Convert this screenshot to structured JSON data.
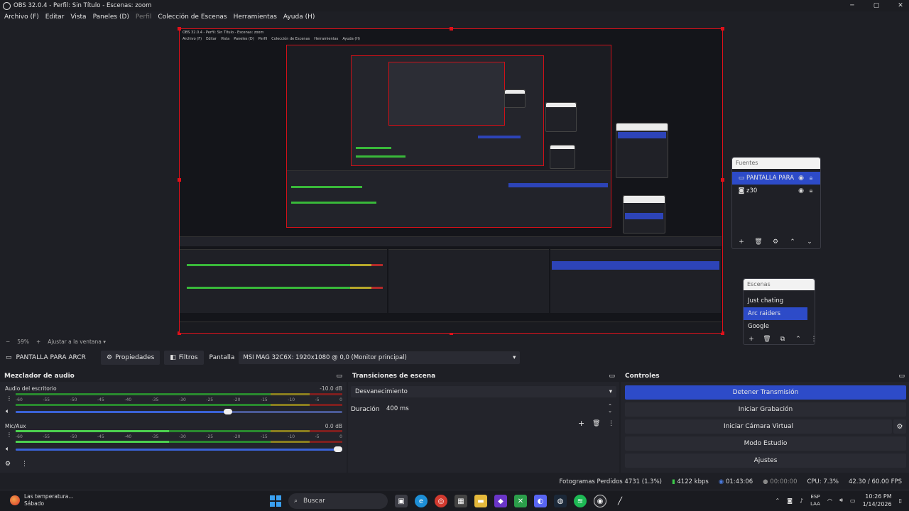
{
  "window": {
    "title": "OBS 32.0.4 - Perfil: Sin Título - Escenas: zoom",
    "minimize": "─",
    "maximize": "▢",
    "close": "✕"
  },
  "menu": [
    {
      "label": "Archivo (F)",
      "disabled": false
    },
    {
      "label": "Editar",
      "disabled": false
    },
    {
      "label": "Vista",
      "disabled": false
    },
    {
      "label": "Paneles (D)",
      "disabled": false
    },
    {
      "label": "Perfil",
      "disabled": true
    },
    {
      "label": "Colección de Escenas",
      "disabled": false
    },
    {
      "label": "Herramientas",
      "disabled": false
    },
    {
      "label": "Ayuda (H)",
      "disabled": false
    }
  ],
  "sources_dock": {
    "title": "Fuentes",
    "items": [
      {
        "name": "PANTALLA PARA ARCR",
        "icon": "monitor-icon",
        "selected": true
      },
      {
        "name": "z30",
        "icon": "camera-icon",
        "selected": false
      }
    ]
  },
  "scenes_dock": {
    "title": "Escenas",
    "items": [
      {
        "name": "Just chating",
        "selected": false
      },
      {
        "name": "Arc raiders",
        "selected": true
      },
      {
        "name": "Google",
        "selected": false
      }
    ]
  },
  "zoom": {
    "minus": "−",
    "level": "59%",
    "plus": "+",
    "fit": "Ajustar a la ventana"
  },
  "source_toolbar": {
    "source_name": "PANTALLA PARA ARCR",
    "properties": "Propiedades",
    "filters": "Filtros",
    "display_label": "Pantalla",
    "display_value": "MSI MAG 32C6X: 1920x1080 @ 0,0 (Monitor principal)"
  },
  "mixer": {
    "title": "Mezclador de audio",
    "ticks": [
      "-60",
      "-55",
      "-50",
      "-45",
      "-40",
      "-35",
      "-30",
      "-25",
      "-20",
      "-15",
      "-10",
      "-5",
      "0"
    ],
    "channels": [
      {
        "name": "Audio del escritorio",
        "db": "-10.0 dB",
        "level": 0,
        "volume": 0.65
      },
      {
        "name": "Mic/Aux",
        "db": "0.0 dB",
        "level": 0.47,
        "volume": 1.0
      }
    ]
  },
  "transitions": {
    "title": "Transiciones de escena",
    "selected": "Desvanecimiento",
    "duration_label": "Duración",
    "duration_value": "400 ms"
  },
  "controls": {
    "title": "Controles",
    "stop_stream": "Detener Transmisión",
    "start_record": "Iniciar Grabación",
    "start_vcam": "Iniciar Cámara Virtual",
    "studio_mode": "Modo Estudio",
    "settings": "Ajustes"
  },
  "stats": {
    "dropped": "Fotogramas Perdidos 4731 (1.3%)",
    "bitrate": "4122 kbps",
    "stream_time": "01:43:06",
    "record_time": "00:00:00",
    "cpu": "CPU: 7.3%",
    "fps": "42.30 / 60.00 FPS"
  },
  "taskbar": {
    "weather_line1": "Las temperatura...",
    "weather_line2": "Sábado",
    "search": "Buscar",
    "lang1": "ESP",
    "lang2": "LAA",
    "time": "10:26 PM",
    "date": "1/14/2026"
  },
  "nested": {
    "title": "OBS 32.0.4 - Perfil: Sin Título - Escenas: zoom",
    "menu": [
      "Archivo (F)",
      "Editar",
      "Vista",
      "Paneles (D)",
      "Perfil",
      "Colección de Escenas",
      "Herramientas",
      "Ayuda (H)"
    ]
  }
}
